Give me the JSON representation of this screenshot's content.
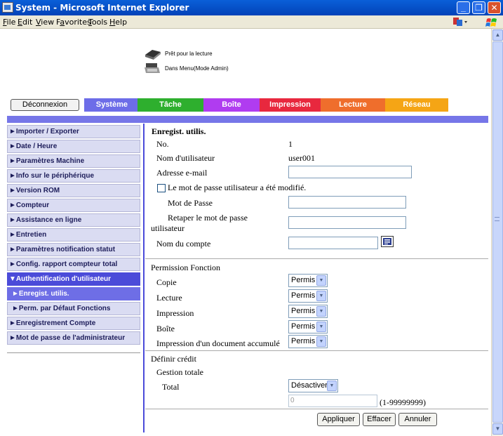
{
  "window": {
    "title": "System - Microsoft Internet Explorer",
    "minimize": "_",
    "maximize": "❐",
    "close": "✕"
  },
  "menu": [
    {
      "label": "File",
      "key": "F"
    },
    {
      "label": "Edit",
      "key": "E"
    },
    {
      "label": "View",
      "key": "V"
    },
    {
      "label": "Favorites",
      "key": "a"
    },
    {
      "label": "Tools",
      "key": "T"
    },
    {
      "label": "Help",
      "key": "H"
    }
  ],
  "status": {
    "line1": "Prêt pour la lecture",
    "line2": "Dans Menu(Mode Admin)"
  },
  "tabs": {
    "logout": "Déconnexion",
    "systeme": "Système",
    "tache": "Tâche",
    "boite": "Boîte",
    "impression": "Impression",
    "lecture": "Lecture",
    "reseau": "Réseau"
  },
  "colors": {
    "systeme": "#6d6de8",
    "tache": "#2eaf2e",
    "boite": "#b03cf0",
    "impression": "#e8283e",
    "lecture": "#ef6e2c",
    "reseau": "#f5a515"
  },
  "sidebar": [
    {
      "label": "►Importer / Exporter"
    },
    {
      "label": "►Date / Heure"
    },
    {
      "label": "►Paramètres Machine"
    },
    {
      "label": "►Info sur le périphérique"
    },
    {
      "label": "►Version ROM"
    },
    {
      "label": "►Compteur"
    },
    {
      "label": "►Assistance en ligne"
    },
    {
      "label": "►Entretien"
    },
    {
      "label": "►Paramètres notification statut"
    },
    {
      "label": "►Config. rapport compteur total"
    },
    {
      "label": "▼Authentification d'utilisateur"
    },
    {
      "label": "►Enregist. utilis."
    },
    {
      "label": "►Perm. par Défaut Fonctions"
    },
    {
      "label": "►Enregistrement Compte"
    },
    {
      "label": "►Mot de passe de l'administrateur"
    }
  ],
  "form": {
    "title": "Enregist. utilis.",
    "no_label": "No.",
    "no_value": "1",
    "user_label": "Nom d'utilisateur",
    "user_value": "user001",
    "email_label": "Adresse e-mail",
    "pwchanged_label": "Le mot de passe utilisateur a été modifié.",
    "password_label": "Mot de Passe",
    "retype_label_1": "Retaper le mot de passe",
    "retype_label_2": "utilisateur",
    "account_label": "Nom du compte",
    "perm_heading": "Permission Fonction",
    "perm_copie": "Copie",
    "perm_lecture": "Lecture",
    "perm_impression": "Impression",
    "perm_boite": "Boîte",
    "perm_doc": "Impression d'un document accumulé",
    "perm_value": "Permis",
    "credit_heading": "Définir crédit",
    "gestion_label": "Gestion totale",
    "total_label": "Total",
    "total_select": "Désactiver",
    "total_input": "0",
    "total_range": "(1-99999999)",
    "apply": "Appliquer",
    "clear": "Effacer",
    "cancel": "Annuler"
  }
}
